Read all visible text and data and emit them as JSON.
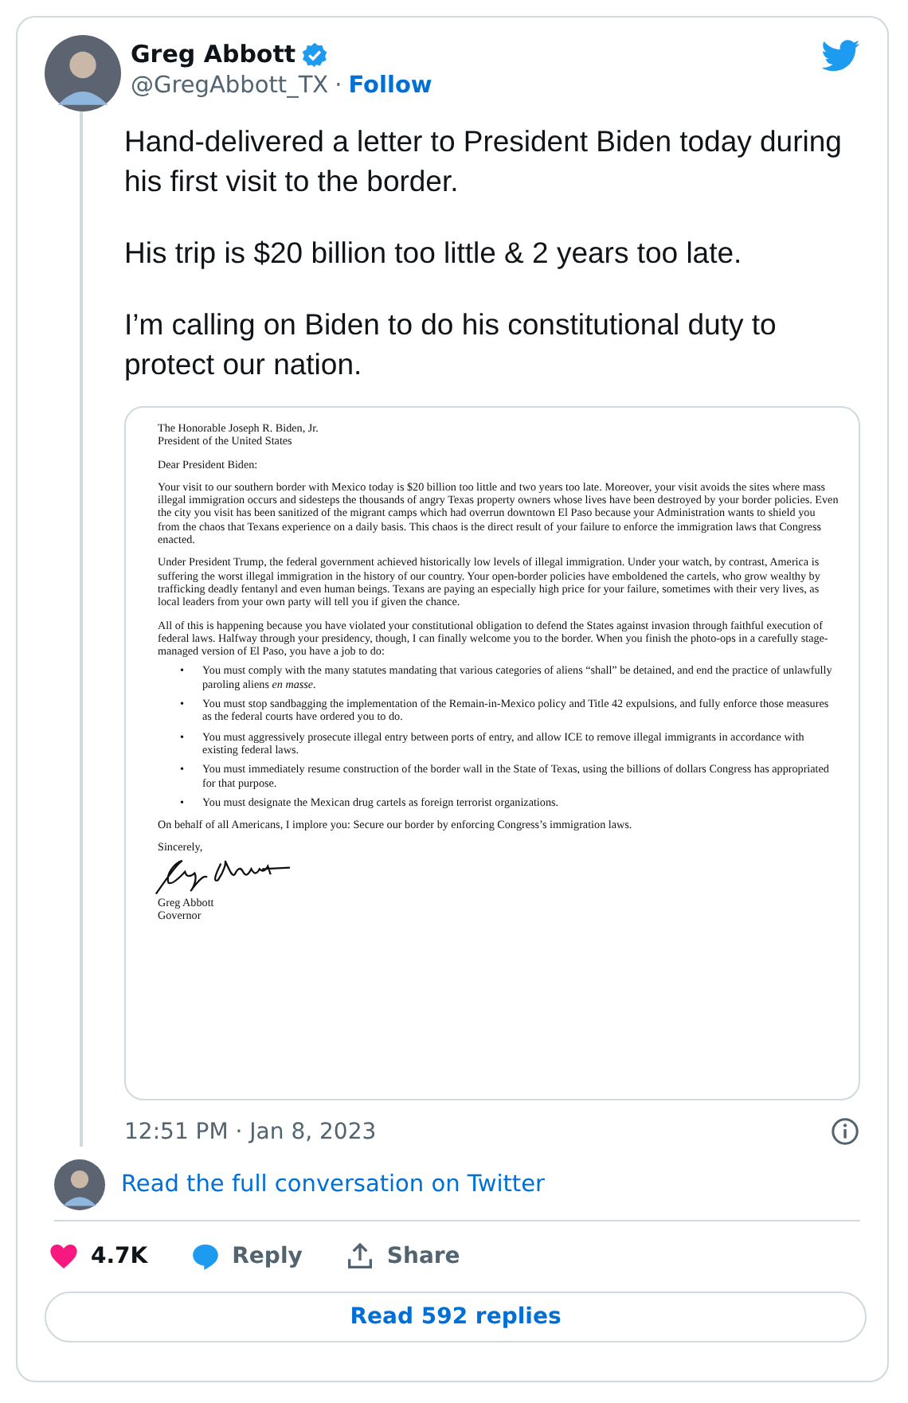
{
  "author": {
    "name": "Greg Abbott",
    "verified": true,
    "handle": "@GregAbbott_TX",
    "separator": "·",
    "follow": "Follow"
  },
  "tweet_paragraphs": [
    "Hand-delivered a letter to President Biden today during his first visit to the border.",
    "His trip is $20 billion too little & 2 years too late.",
    "I’m calling on Biden to do his constitutional duty to protect our nation."
  ],
  "letter": {
    "address": [
      "The Honorable Joseph R. Biden, Jr.",
      "President of the United States"
    ],
    "salutation": "Dear President Biden:",
    "paragraphs": [
      "Your visit to our southern border with Mexico today is $20 billion too little and two years too late. Moreover, your visit avoids the sites where mass illegal immigration occurs and sidesteps the thousands of angry Texas property owners whose lives have been destroyed by your border policies.  Even the city you visit has been sanitized of the migrant camps which had overrun downtown El Paso because your Administration wants to shield you from the chaos that Texans experience on a daily basis.  This chaos is the direct result of your failure to enforce the immigration laws that Congress enacted.",
      "Under President Trump, the federal government achieved historically low levels of illegal immigration.  Under your watch, by contrast, America is suffering the worst illegal immigration in the history of our country.  Your open-border policies have emboldened the cartels, who grow wealthy by trafficking deadly fentanyl and even human beings.  Texans are paying an especially high price for your failure, sometimes with their very lives, as local leaders from your own party will tell you if given the chance.",
      "All of this is happening because you have violated your constitutional obligation to defend the States against invasion through faithful execution of federal laws.  Halfway through your presidency, though, I can finally welcome you to the border.  When you finish the photo-ops in a carefully stage-managed version of El Paso, you have a job to do:"
    ],
    "bullets": [
      {
        "marker": "•",
        "text": "You must comply with the many statutes mandating that various categories of aliens “shall” be detained, and end the practice of unlawfully paroling aliens *en masse*."
      },
      {
        "marker": "•",
        "text": "You must stop sandbagging the implementation of the Remain-in-Mexico policy and Title 42 expulsions, and fully enforce those measures as the federal courts have ordered you to do."
      },
      {
        "marker": "•",
        "text": "You must aggressively prosecute illegal entry between ports of entry, and allow ICE to remove illegal immigrants in accordance with existing federal laws."
      },
      {
        "marker": "•",
        "text": "You must immediately resume construction of the border wall in the State of Texas, using the billions of dollars Congress has appropriated for that purpose."
      },
      {
        "marker": "•",
        "text": "You must designate the Mexican drug cartels as foreign terrorist organizations."
      }
    ],
    "closing_paragraph": "On behalf of all Americans, I implore you: Secure our border by enforcing Congress’s immigration laws.",
    "valediction": "Sincerely,",
    "signer_name": "Greg Abbott",
    "signer_title": "Governor"
  },
  "timestamp": "12:51 PM · Jan 8, 2023",
  "conversation_link": "Read the full conversation on Twitter",
  "actions": [
    {
      "kind": "like",
      "label": "4.7K"
    },
    {
      "kind": "reply",
      "label": "Reply"
    },
    {
      "kind": "share",
      "label": "Share"
    }
  ],
  "replies_button": "Read 592 replies"
}
